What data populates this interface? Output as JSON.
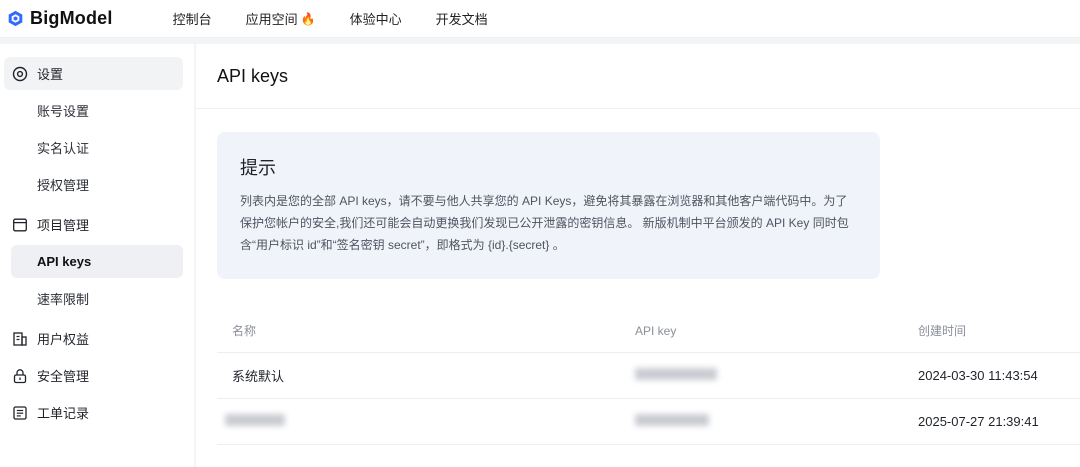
{
  "brand": {
    "name": "BigModel",
    "logo_color": "#2f6bff"
  },
  "topnav": [
    {
      "label": "控制台"
    },
    {
      "label": "应用空间",
      "badge_icon": "fire-icon"
    },
    {
      "label": "体验中心"
    },
    {
      "label": "开发文档"
    }
  ],
  "sidebar": {
    "settings": "设置",
    "account": "账号设置",
    "realname": "实名认证",
    "auth": "授权管理",
    "project": "项目管理",
    "apikeys": "API keys",
    "ratelimit": "速率限制",
    "rights": "用户权益",
    "security": "安全管理",
    "tickets": "工单记录"
  },
  "page": {
    "title": "API keys",
    "tip_title": "提示",
    "tip_body": "列表内是您的全部 API keys，请不要与他人共享您的 API Keys，避免将其暴露在浏览器和其他客户端代码中。为了保护您帐户的安全,我们还可能会自动更换我们发现已公开泄露的密钥信息。 新版机制中平台颁发的 API Key 同时包含“用户标识 id”和“签名密钥 secret”，即格式为 {id}.{secret} 。"
  },
  "table": {
    "headers": {
      "name": "名称",
      "key": "API key",
      "created": "创建时间"
    },
    "rows": [
      {
        "name": "系统默认",
        "key_masked": true,
        "created": "2024-03-30 11:43:54"
      },
      {
        "name_masked": true,
        "key_masked": true,
        "created": "2025-07-27 21:39:41"
      }
    ]
  }
}
